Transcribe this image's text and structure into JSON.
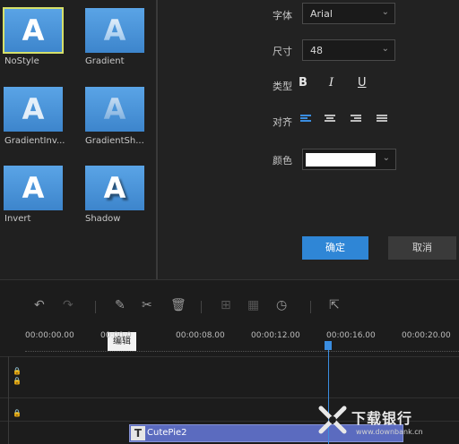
{
  "styles": [
    {
      "label": "NoStyle",
      "glyph": "A",
      "selected": true
    },
    {
      "label": "Gradient",
      "glyph": "A",
      "selected": false
    },
    {
      "label": "GradientInv...",
      "glyph": "A",
      "selected": false
    },
    {
      "label": "GradientSh...",
      "glyph": "A",
      "selected": false
    },
    {
      "label": "Invert",
      "glyph": "A",
      "selected": false
    },
    {
      "label": "Shadow",
      "glyph": "A",
      "selected": false
    }
  ],
  "form": {
    "font_label": "字体",
    "font_value": "Arial",
    "size_label": "尺寸",
    "size_value": "48",
    "type_label": "类型",
    "bold": "B",
    "italic": "I",
    "underline": "U",
    "align_label": "对齐",
    "color_label": "颜色",
    "color_value": "#ffffff",
    "ok_label": "确定",
    "cancel_label": "取消"
  },
  "timeline": {
    "tooltip": "编辑",
    "ticks": [
      "00:00:00.00",
      "00:00:0",
      "00:00:08.00",
      "00:00:12.00",
      "00:00:16.00",
      "00:00:20.00"
    ],
    "clip_label": "CutePie2"
  },
  "watermark": {
    "main": "下载银行",
    "sub": "www.downbank.cn"
  },
  "colors": {
    "accent": "#2f86d6",
    "clip": "#5b6bbf",
    "selected_outline": "#d6e06a"
  }
}
